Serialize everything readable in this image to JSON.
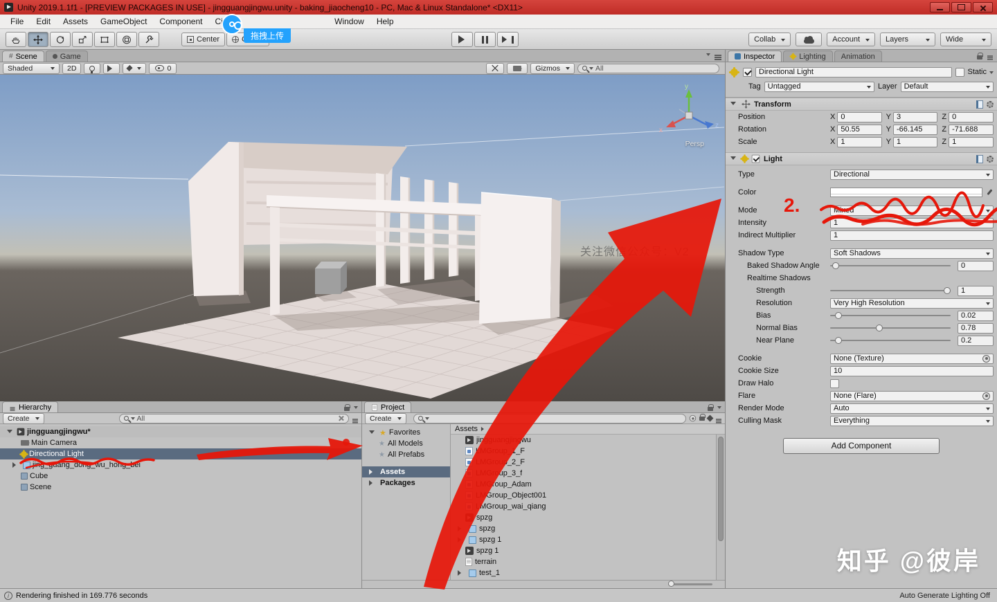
{
  "icons": {
    "hash": "#",
    "star": "★",
    "info": "i"
  },
  "title_bar": {
    "app_title": "Unity 2019.1.1f1 - [PREVIEW PACKAGES IN USE] - jingguangjingwu.unity - baking_jiaocheng10 - PC, Mac & Linux Standalone* <DX11>"
  },
  "menu": {
    "items": [
      "File",
      "Edit",
      "Assets",
      "GameObject",
      "Component",
      "Cine",
      "Window",
      "Help"
    ]
  },
  "upload_overlay": {
    "label": "拖拽上传"
  },
  "toolbar": {
    "pivot": "Center",
    "space": "Global",
    "collab": "Collab",
    "account": "Account",
    "layers": "Layers",
    "layout": "Wide"
  },
  "scene": {
    "tab_scene": "Scene",
    "tab_game": "Game",
    "shading": "Shaded",
    "mode_2d": "2D",
    "hidden_count": "0",
    "gizmos": "Gizmos",
    "search_value": "All",
    "persp": "Persp",
    "watermark": "关注微信公众号：V2",
    "axis": {
      "x": "x",
      "y": "y",
      "z": "z"
    }
  },
  "hierarchy": {
    "tab": "Hierarchy",
    "create": "Create",
    "search_value": "All",
    "items": [
      {
        "label": "jingguangjingwu*",
        "icon": "unity-scene"
      },
      {
        "label": "Main Camera",
        "icon": "camera"
      },
      {
        "label": "Directional Light",
        "icon": "directional-light",
        "selected": true
      },
      {
        "label": "jing_guang_dong_wu_hong_bei",
        "icon": "prefab"
      },
      {
        "label": "Cube",
        "icon": "cube"
      },
      {
        "label": "Scene",
        "icon": "cube"
      }
    ]
  },
  "project": {
    "tab": "Project",
    "create": "Create",
    "favorites_label": "Favorites",
    "breadcrumb": "Assets",
    "fav_items": [
      {
        "label": "All Models"
      },
      {
        "label": "All Prefabs"
      }
    ],
    "folders": [
      {
        "label": "Assets",
        "selected": true
      },
      {
        "label": "Packages"
      }
    ],
    "assets": [
      {
        "label": "jingguangjingwu",
        "icon": "unity"
      },
      {
        "label": "LMGroup_1_F",
        "icon": "lightmap"
      },
      {
        "label": "LMGroup_2_F",
        "icon": "lightmap"
      },
      {
        "label": "LMGroup_3_f",
        "icon": "lightmap"
      },
      {
        "label": "LMGroup_Adam",
        "icon": "lightmap"
      },
      {
        "label": "LMGroup_Object001",
        "icon": "lightmap"
      },
      {
        "label": "LMGroup_wai_qiang",
        "icon": "lightmap"
      },
      {
        "label": "spzg",
        "icon": "unity"
      },
      {
        "label": "spzg",
        "icon": "prefab",
        "expand": true
      },
      {
        "label": "spzg 1",
        "icon": "prefab",
        "expand": true
      },
      {
        "label": "spzg 1",
        "icon": "unity"
      },
      {
        "label": "terrain",
        "icon": "doc"
      },
      {
        "label": "test_1",
        "icon": "prefab",
        "expand": true
      }
    ]
  },
  "inspector": {
    "tabs": {
      "inspector": "Inspector",
      "lighting": "Lighting",
      "animation": "Animation"
    },
    "header": {
      "name": "Directional Light",
      "static_label": "Static",
      "tag_label": "Tag",
      "tag": "Untagged",
      "layer_label": "Layer",
      "layer": "Default"
    },
    "transform": {
      "title": "Transform",
      "axis": {
        "x": "X",
        "y": "Y",
        "z": "Z"
      },
      "position": {
        "label": "Position",
        "x": "0",
        "y": "3",
        "z": "0"
      },
      "rotation": {
        "label": "Rotation",
        "x": "50.55",
        "y": "-66.145",
        "z": "-71.688"
      },
      "scale": {
        "label": "Scale",
        "x": "1",
        "y": "1",
        "z": "1"
      }
    },
    "light": {
      "title": "Light",
      "type_label": "Type",
      "type": "Directional",
      "color_label": "Color",
      "mode_label": "Mode",
      "mode": "Mixed",
      "intensity_label": "Intensity",
      "intensity": "1",
      "indirect_label": "Indirect Multiplier",
      "indirect": "1",
      "shadow_label": "Shadow Type",
      "shadow": "Soft Shadows",
      "baked_label": "Baked Shadow Angle",
      "baked": "0",
      "realtime_label": "Realtime Shadows",
      "strength_label": "Strength",
      "strength": "1",
      "resolution_label": "Resolution",
      "resolution": "Very High Resolution",
      "bias_label": "Bias",
      "bias": "0.02",
      "nbias_label": "Normal Bias",
      "nbias": "0.78",
      "near_label": "Near Plane",
      "near": "0.2",
      "cookie_label": "Cookie",
      "cookie": "None (Texture)",
      "csize_label": "Cookie Size",
      "csize": "10",
      "halo_label": "Draw Halo",
      "flare_label": "Flare",
      "flare": "None (Flare)",
      "render_label": "Render Mode",
      "render": "Auto",
      "culling_label": "Culling Mask",
      "culling": "Everything"
    },
    "add_component": "Add Component"
  },
  "status": {
    "left": "Rendering finished in 169.776 seconds",
    "right": "Auto Generate Lighting Off"
  },
  "annotations": {
    "step": "2."
  },
  "watermark": {
    "zhihu": "知乎 @彼岸"
  }
}
